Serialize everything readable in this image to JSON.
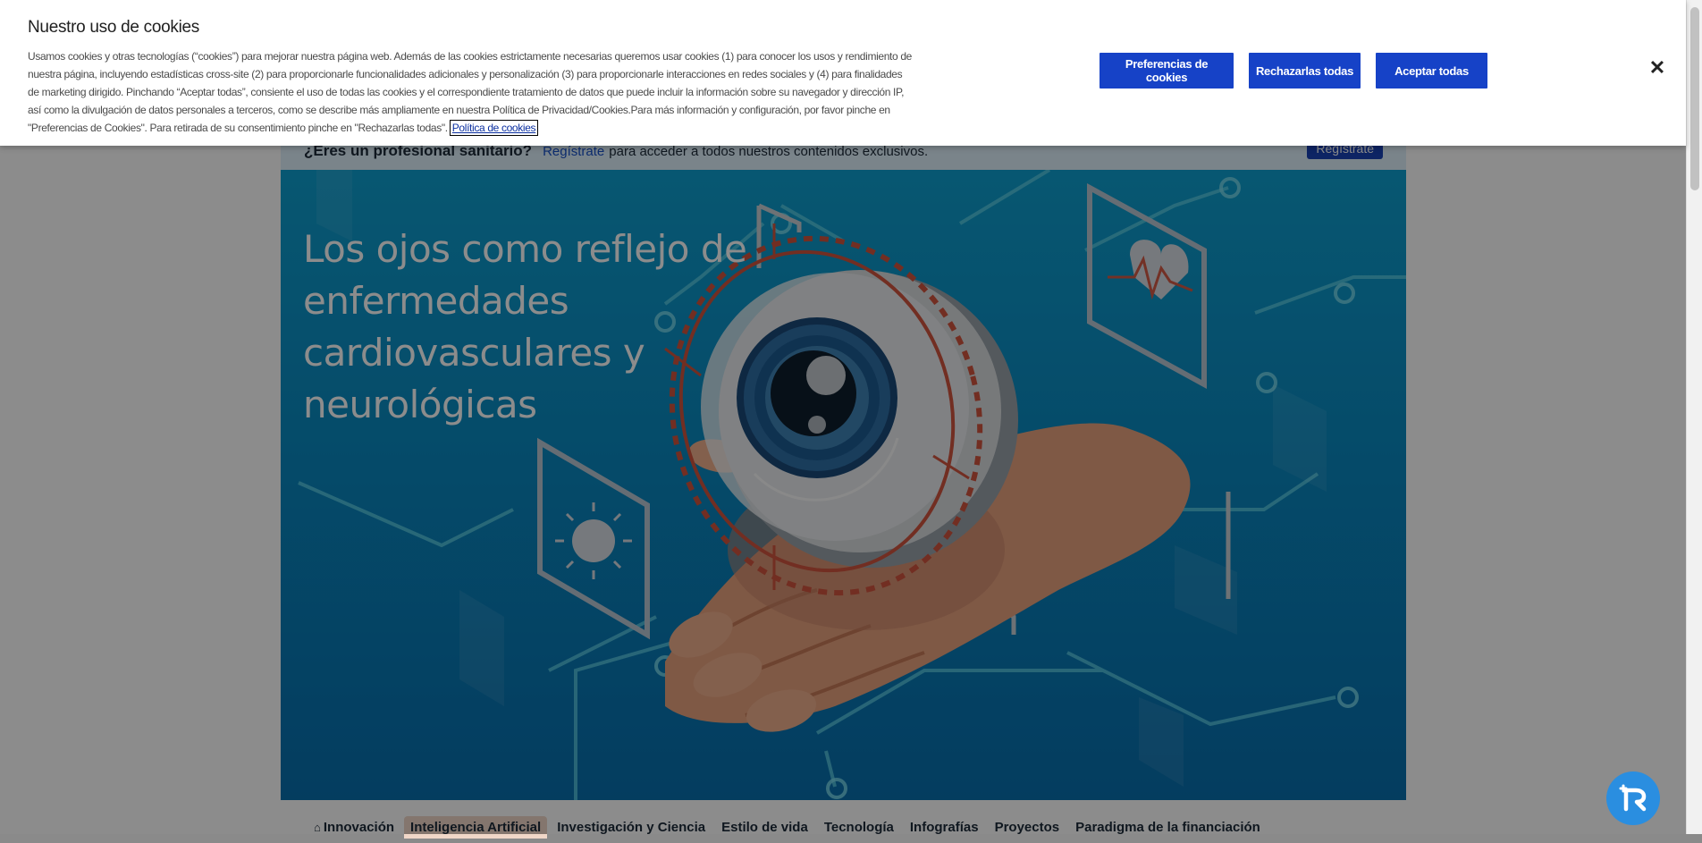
{
  "pro_banner": {
    "question": "¿Eres un profesional sanitario?",
    "link": "Regístrate",
    "text": "para acceder a todos nuestros contenidos exclusivos.",
    "button": "Regístrate"
  },
  "hero": {
    "title": "Los ojos como reflejo de enfermedades cardiovasculares y neurológicas"
  },
  "tabs": [
    {
      "label": "Innovación",
      "icon": "home-icon"
    },
    {
      "label": "Inteligencia Artificial",
      "active": true
    },
    {
      "label": "Investigación y Ciencia"
    },
    {
      "label": "Estilo de vida"
    },
    {
      "label": "Tecnología"
    },
    {
      "label": "Infografías"
    },
    {
      "label": "Proyectos"
    },
    {
      "label": "Paradigma de la financiación"
    }
  ],
  "cookie_banner": {
    "title": "Nuestro uso de cookies",
    "description": "Usamos cookies y otras tecnologías (“cookies”) para mejorar nuestra página web. Además de las cookies estrictamente necesarias queremos usar cookies (1) para conocer los usos y rendimiento de nuestra página, incluyendo estadísticas cross-site (2) para proporcionarle funcionalidades adicionales y personalización (3) para proporcionarle interacciones en redes sociales y (4) para finalidades de marketing dirigido. Pinchando “Aceptar todas”, consiente el uso de todas las cookies y el correspondiente tratamiento de datos que puede incluir la información sobre su navegador y dirección IP, así como la divulgación de datos personales a terceros, como se describe más ampliamente en nuestra Política de Privacidad/Cookies.Para más información y configuración, por favor pinche en \"Preferencias de Cookies\". Para retirada de su consentimiento pinche en \"Rechazarlas todas\".",
    "policy_link": "Política de cookies",
    "preferences_button": "Preferencias de cookies",
    "reject_button": "Rechazarlas todas",
    "accept_button": "Aceptar todas",
    "close_icon": "close-icon"
  },
  "colors": {
    "button_blue": "#1642c7",
    "hero_blue": "#0a8bc2",
    "fab_blue": "#2a8ee0"
  }
}
